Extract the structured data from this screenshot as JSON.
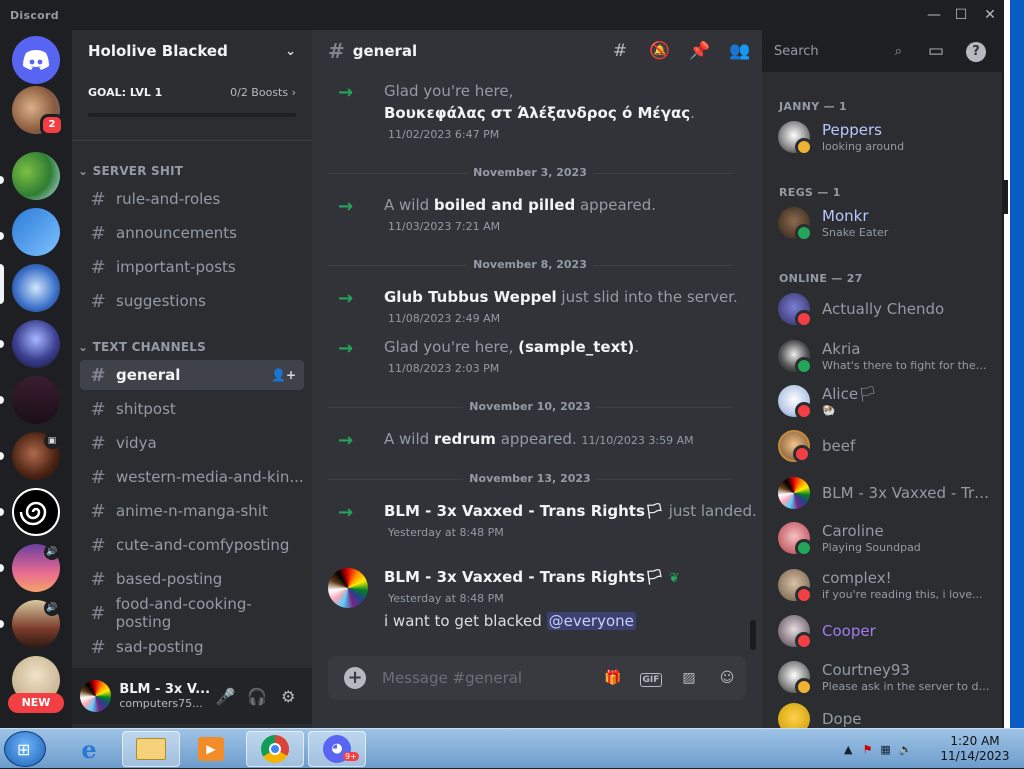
{
  "window": {
    "app_title": "Discord",
    "minimize": "—",
    "maximize": "☐",
    "close": "✕"
  },
  "rail": {
    "badge_1": "2",
    "new_label": "NEW"
  },
  "server": {
    "name": "Hololive Blacked",
    "boost_goal": "GOAL: LVL 1",
    "boost_count": "0/2 Boosts",
    "categories": [
      "SERVER SHIT",
      "TEXT CHANNELS"
    ],
    "channels": [
      "rule-and-roles",
      "announcements",
      "important-posts",
      "suggestions",
      "general",
      "shitpost",
      "vidya",
      "western-media-and-kin...",
      "anime-n-manga-shit",
      "cute-and-comfyposting",
      "based-posting",
      "food-and-cooking-posting",
      "sad-posting"
    ]
  },
  "user": {
    "name": "BLM - 3x V...",
    "tag": "computers75..."
  },
  "chat": {
    "channel": "general",
    "search_placeholder": "Search",
    "composer_placeholder": "Message #general",
    "gif_label": "GIF",
    "messages": [
      {
        "pre": "Glad you're here,",
        "name": "",
        "post": ""
      },
      {
        "pre": "",
        "name": "Βουκεφάλας στ Άλέξανδρος ό Μέγας",
        "post": "."
      },
      {
        "ts": "11/02/2023 6:47 PM"
      },
      {
        "date": "November 3, 2023"
      },
      {
        "pre": "A wild ",
        "name": "boiled and pilled",
        "post": " appeared.",
        "ts": "11/03/2023 7:21 AM"
      },
      {
        "date": "November 8, 2023"
      },
      {
        "pre": "",
        "name": "Glub Tubbus Weppel",
        "post": " just slid into the server.",
        "ts": "11/08/2023 2:49 AM"
      },
      {
        "pre": "Glad you're here, ",
        "name": "(sample_text)",
        "post": ".",
        "ts": "11/08/2023 2:03 PM"
      },
      {
        "date": "November 10, 2023"
      },
      {
        "pre": "A wild ",
        "name": "redrum",
        "post": " appeared.",
        "ts": "11/10/2023 3:59 AM"
      },
      {
        "date": "November 13, 2023"
      },
      {
        "pre": "",
        "name": "BLM - 3x Vaxxed - Trans Rights🏳",
        "post": " just landed.",
        "ts": "Yesterday at 8:48 PM"
      },
      {
        "author": "BLM - 3x Vaxxed - Trans Rights🏳",
        "ts": "Yesterday at 8:48 PM",
        "body": "i want to get blacked",
        "mention": "@everyone"
      }
    ]
  },
  "members": {
    "categories": [
      "JANNY — 1",
      "REGS — 1",
      "ONLINE — 27"
    ],
    "list": [
      {
        "name": "Peppers",
        "sub": "looking around"
      },
      {
        "name": "Monkr",
        "sub": "Snake Eater"
      },
      {
        "name": "Actually Chendo",
        "sub": ""
      },
      {
        "name": "Akria",
        "sub": "What's there to fight for these..."
      },
      {
        "name": "Alice🏳",
        "sub": "🐏"
      },
      {
        "name": "beef",
        "sub": ""
      },
      {
        "name": "BLM - 3x Vaxxed - Tra...",
        "sub": ""
      },
      {
        "name": "Caroline",
        "sub": "Playing Soundpad"
      },
      {
        "name": "complex!",
        "sub": "if you're reading this, i love..."
      },
      {
        "name": "Cooper",
        "sub": ""
      },
      {
        "name": "Courtney93",
        "sub": "Please ask in the server to dm..."
      },
      {
        "name": "Dope",
        "sub": ""
      }
    ]
  },
  "taskbar": {
    "time": "1:20 AM",
    "date": "11/14/2023",
    "discord_badge": "9+"
  },
  "colors": {
    "online": "#23a55a",
    "dnd": "#f23f43",
    "idle": "#f0b232",
    "accent_link": "#c9cdfb"
  }
}
